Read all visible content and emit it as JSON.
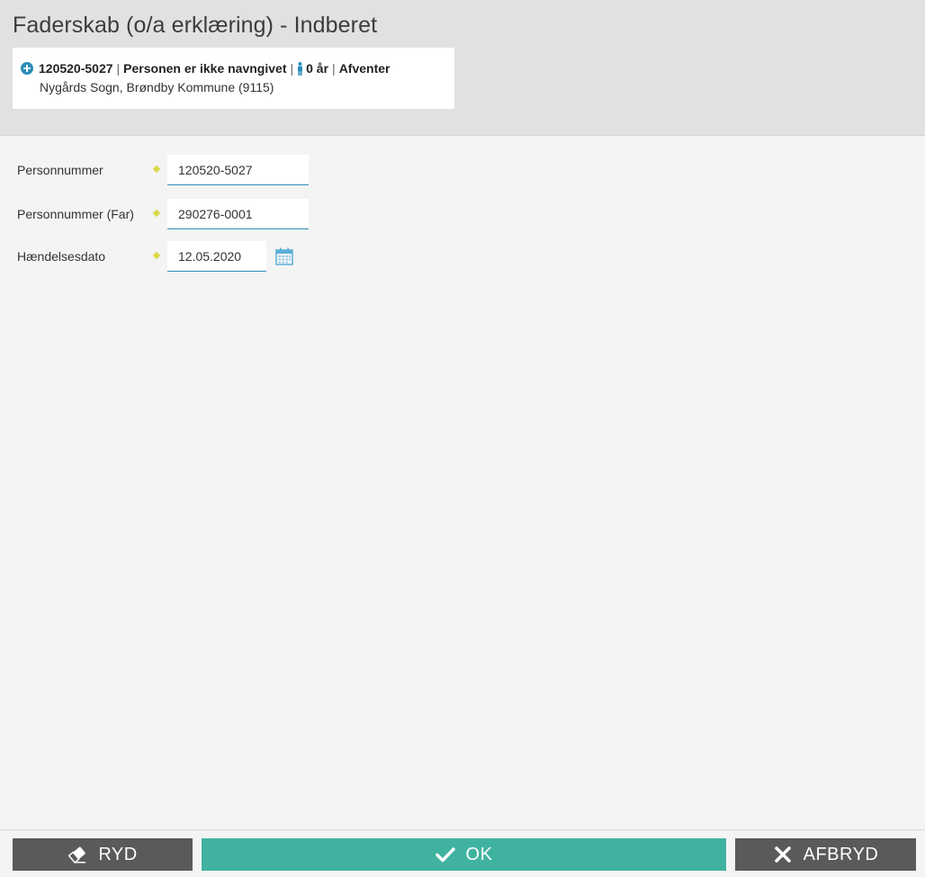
{
  "header": {
    "title": "Faderskab (o/a erklæring) - Indberet"
  },
  "person_card": {
    "cpr": "120520-5027",
    "name_status": "Personen er ikke navngivet",
    "age": "0 år",
    "status": "Afventer",
    "separator": "|",
    "location": "Nygårds Sogn, Brøndby Kommune (9115)",
    "plus_icon": "plus-circle-icon",
    "person_icon": "person-icon"
  },
  "form": {
    "fields": [
      {
        "label": "Personnummer",
        "value": "120520-5027"
      },
      {
        "label": "Personnummer (Far)",
        "value": "290276-0001"
      },
      {
        "label": "Hændelsesdato",
        "value": "12.05.2020"
      }
    ],
    "calendar_icon": "calendar-icon"
  },
  "footer": {
    "ryd_label": "RYD",
    "ok_label": "OK",
    "afbryd_label": "AFBRYD",
    "ryd_icon": "eraser-icon",
    "ok_icon": "check-icon",
    "afbryd_icon": "close-icon"
  },
  "colors": {
    "header_bg": "#e1e1e1",
    "page_bg": "#f4f4f4",
    "accent_blue": "#2a8db8",
    "ok_green": "#3fb3a0",
    "button_gray": "#5a5a5a",
    "required_marker": "#d9d84a"
  }
}
